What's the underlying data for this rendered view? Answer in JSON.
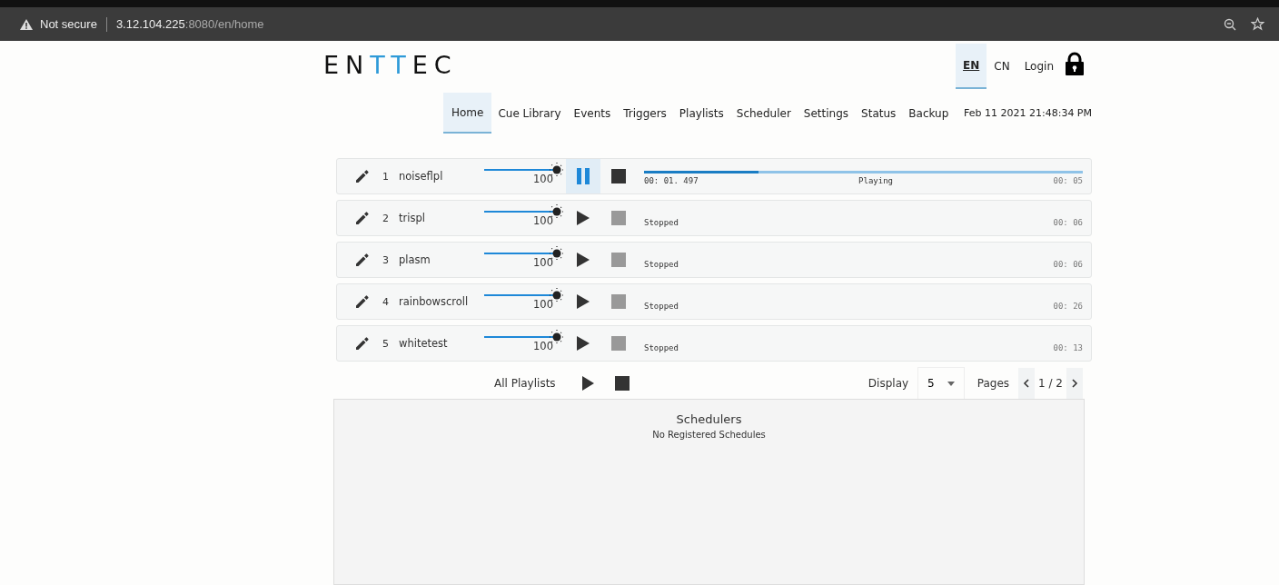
{
  "browser": {
    "security": "Not secure",
    "host": "3.12.104.225",
    "path": ":8080/en/home"
  },
  "logo": [
    {
      "text": "EN",
      "accent": false
    },
    {
      "text": "TT",
      "accent": true
    },
    {
      "text": "EC",
      "accent": false
    }
  ],
  "languages": [
    {
      "label": "EN",
      "selected": true
    },
    {
      "label": "CN",
      "selected": false
    }
  ],
  "login": "Login",
  "nav": [
    {
      "label": "Home",
      "selected": true
    },
    {
      "label": "Cue Library",
      "selected": false
    },
    {
      "label": "Events",
      "selected": false
    },
    {
      "label": "Triggers",
      "selected": false
    },
    {
      "label": "Playlists",
      "selected": false
    },
    {
      "label": "Scheduler",
      "selected": false
    },
    {
      "label": "Settings",
      "selected": false
    },
    {
      "label": "Status",
      "selected": false
    },
    {
      "label": "Backup",
      "selected": false
    }
  ],
  "datetime": "Feb 11 2021 21:48:34 PM",
  "playlists": [
    {
      "number": "1",
      "name": "noiseflpl",
      "level": 1,
      "intensity": "100",
      "playing": true,
      "elapsed": "00: 01. 497",
      "status": "Playing",
      "progress": {
        "level": 0.26
      },
      "duration": "00: 05"
    },
    {
      "number": "2",
      "name": "trispl",
      "level": 1,
      "intensity": "100",
      "playing": false,
      "status": "Stopped",
      "duration": "00: 06"
    },
    {
      "number": "3",
      "name": "plasm",
      "level": 1,
      "intensity": "100",
      "playing": false,
      "status": "Stopped",
      "duration": "00: 06"
    },
    {
      "number": "4",
      "name": "rainbowscroll",
      "level": 1,
      "intensity": "100",
      "playing": false,
      "status": "Stopped",
      "duration": "00: 26"
    },
    {
      "number": "5",
      "name": "whitetest",
      "level": 1,
      "intensity": "100",
      "playing": false,
      "status": "Stopped",
      "duration": "00: 13"
    }
  ],
  "all_playlists": "All Playlists",
  "display": {
    "label": "Display",
    "value": "5"
  },
  "pages": {
    "label": "Pages",
    "value": "1 / 2"
  },
  "schedulers": {
    "title": "Schedulers",
    "message": "No Registered Schedules"
  }
}
